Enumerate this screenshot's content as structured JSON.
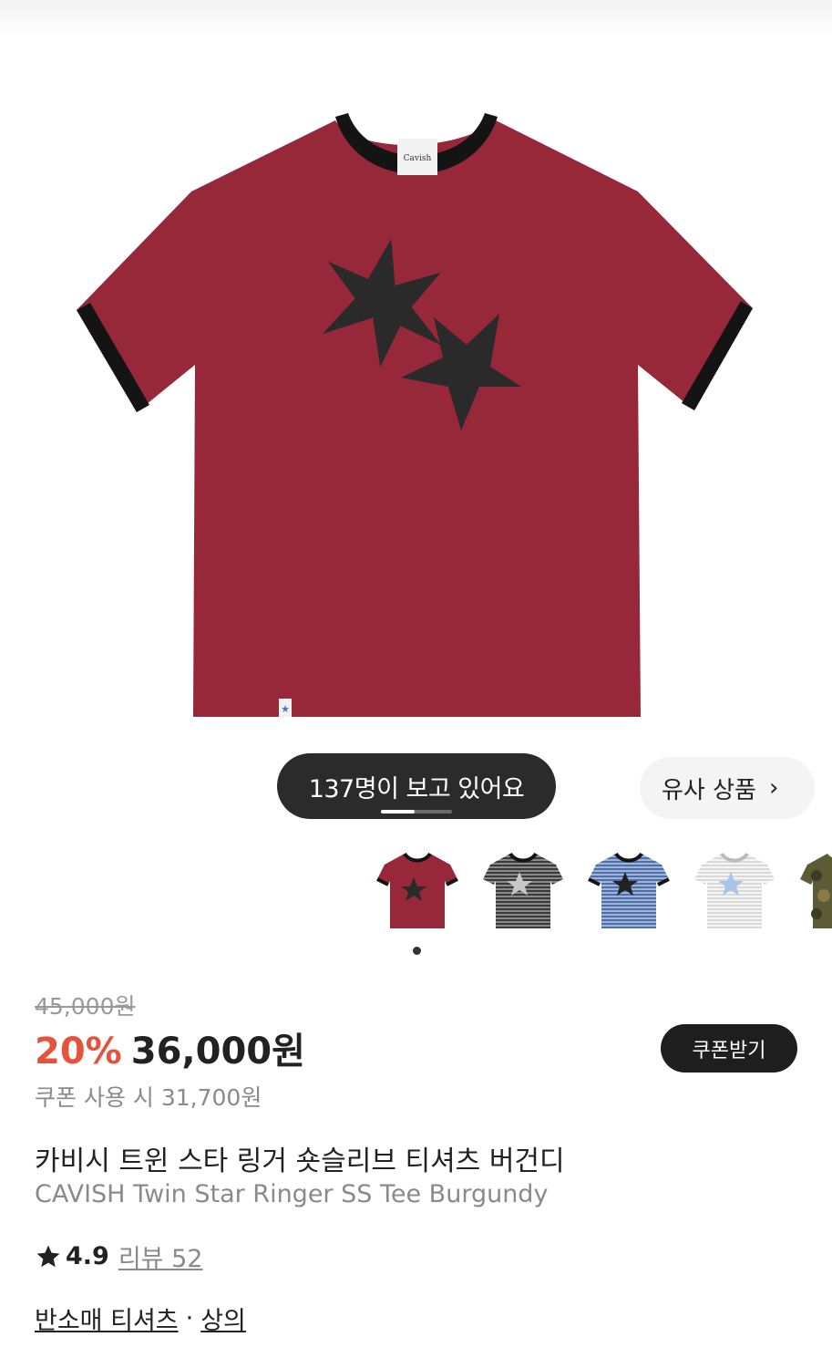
{
  "product_image": {
    "alt": "카비시 트윈 스타 링거 숏슬리브 티셔츠 버건디",
    "body_color": "#96283a",
    "trim_color": "#141414",
    "star_color": "#2a2a2a"
  },
  "viewers_badge": {
    "label": "137명이 보고 있어요"
  },
  "image_progress": {
    "fraction": 0.47
  },
  "similar_button": {
    "label": "유사 상품",
    "icon": "chevron-right-icon"
  },
  "color_thumbnails": [
    {
      "name": "burgundy",
      "body": "#96283a",
      "selected": true
    },
    {
      "name": "black-stripe",
      "body": "#3a3a3a",
      "stripe": "#8a8a8a"
    },
    {
      "name": "blue-stripe",
      "body": "#4f6fa8",
      "stripe": "#9fb4d8"
    },
    {
      "name": "gray-stripe",
      "body": "#d9d9d9",
      "stripe": "#f5f5f5"
    },
    {
      "name": "camo",
      "body": "#5b5b35"
    }
  ],
  "price": {
    "original": "45,000원",
    "discount": "20%",
    "sale": "36,000원",
    "coupon_price": "쿠폰 사용 시 31,700원"
  },
  "coupon_button": {
    "label": "쿠폰받기"
  },
  "product": {
    "name_ko": "카비시 트윈 스타 링거 숏슬리브 티셔츠 버건디",
    "name_en": "CAVISH Twin Star Ringer SS Tee Burgundy"
  },
  "rating": {
    "value": "4.9",
    "review_label": "리뷰 52",
    "icon": "star-icon"
  },
  "category": {
    "primary": "반소매 티셔츠",
    "separator": "·",
    "secondary": "상의"
  },
  "colors": {
    "accent": "#e5533d",
    "dark": "#1e1e1e"
  }
}
